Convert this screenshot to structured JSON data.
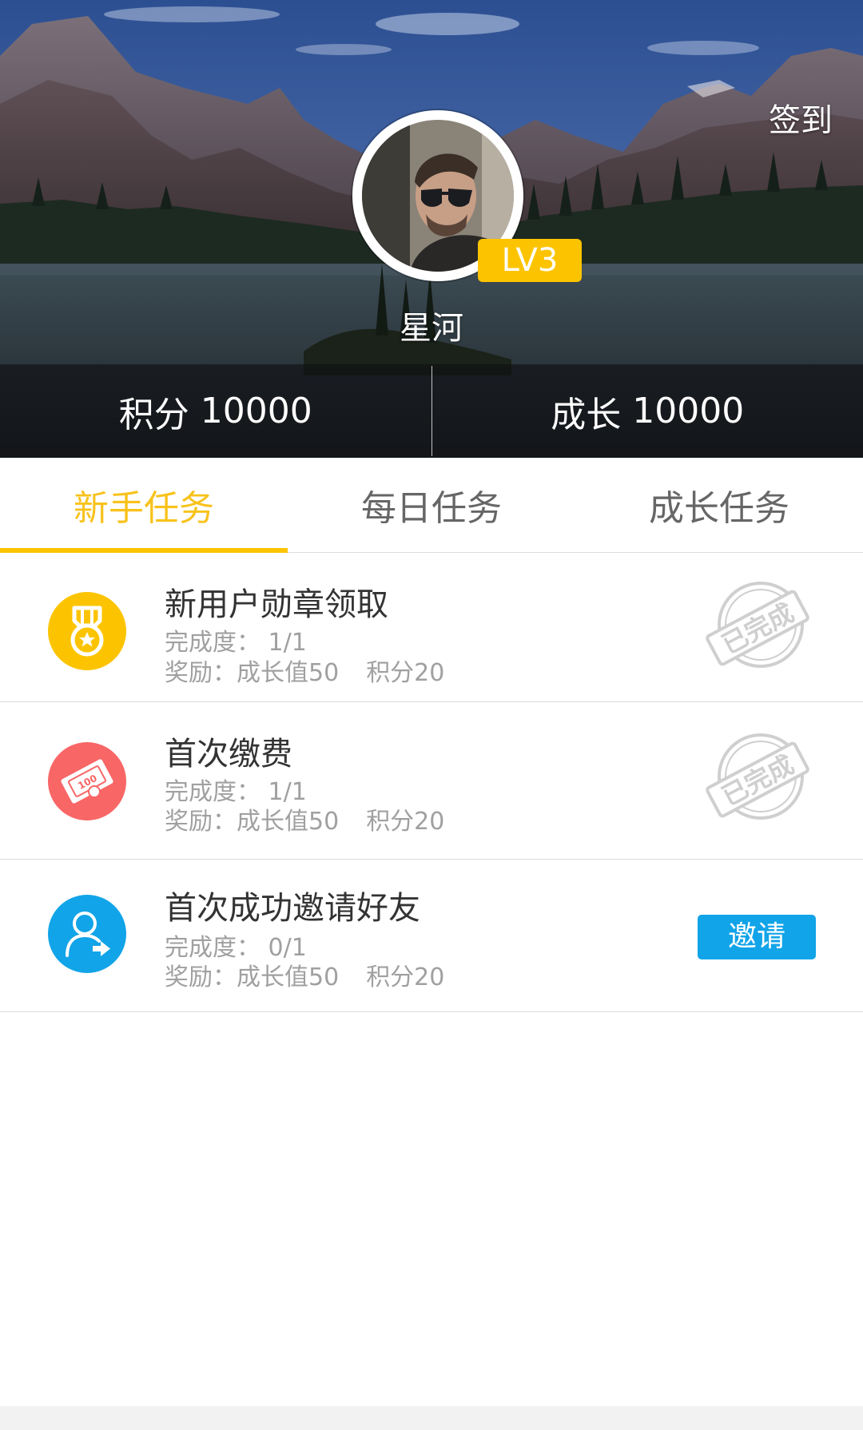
{
  "header": {
    "checkin_label": "签到",
    "username": "星河",
    "level": "LV3",
    "stats": [
      {
        "label": "积分",
        "value": "10000"
      },
      {
        "label": "成长",
        "value": "10000"
      }
    ]
  },
  "tabs": [
    {
      "label": "新手任务",
      "active": true
    },
    {
      "label": "每日任务",
      "active": false
    },
    {
      "label": "成长任务",
      "active": false
    }
  ],
  "tasks": [
    {
      "title": "新用户勋章领取",
      "progress_label": "完成度：",
      "progress": "1/1",
      "reward_label": "奖励：",
      "reward_growth": "成长值50",
      "reward_points": "积分20",
      "icon": "medal-icon",
      "icon_color": "#fcc400",
      "status": "completed",
      "stamp_text": "已完成"
    },
    {
      "title": "首次缴费",
      "progress_label": "完成度：",
      "progress": "1/1",
      "reward_label": "奖励：",
      "reward_growth": "成长值50",
      "reward_points": "积分20",
      "icon": "payment-ticket-icon",
      "icon_color": "#f86666",
      "status": "completed",
      "stamp_text": "已完成"
    },
    {
      "title": "首次成功邀请好友",
      "progress_label": "完成度：",
      "progress": "0/1",
      "reward_label": "奖励：",
      "reward_growth": "成长值50",
      "reward_points": "积分20",
      "icon": "invite-user-icon",
      "icon_color": "#12a4e8",
      "status": "pending",
      "action_label": "邀请"
    }
  ],
  "colors": {
    "accent": "#fcc400",
    "tab_active_text": "#f8c21c",
    "invite_button": "#12a4e8"
  }
}
